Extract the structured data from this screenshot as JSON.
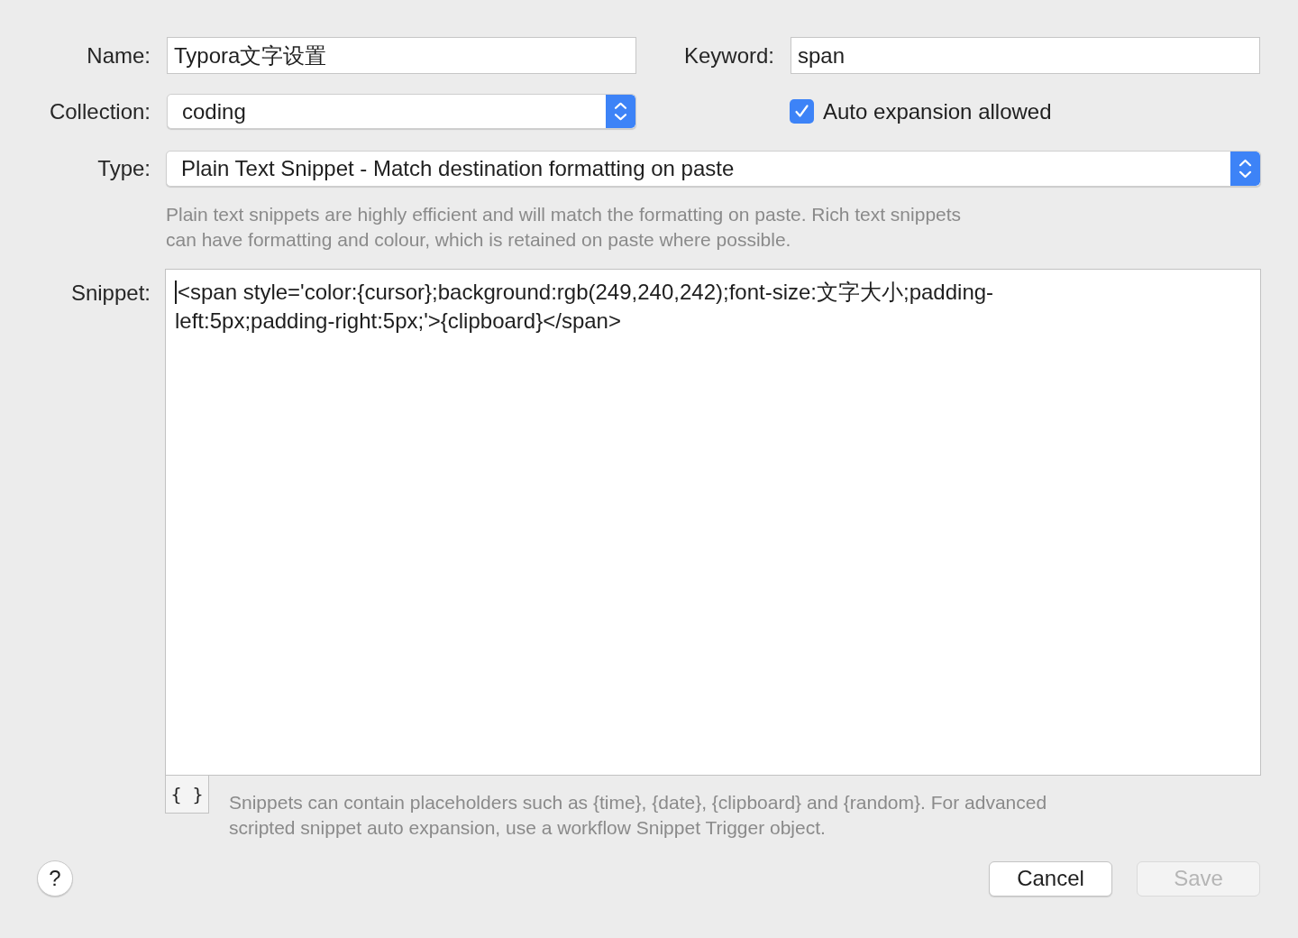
{
  "form": {
    "name": {
      "label": "Name:",
      "value": "Typora文字设置"
    },
    "keyword": {
      "label": "Keyword:",
      "value": "span"
    },
    "collection": {
      "label": "Collection:",
      "value": "coding"
    },
    "auto_expansion": {
      "label": "Auto expansion allowed",
      "checked": true
    },
    "type": {
      "label": "Type:",
      "value": "Plain Text Snippet - Match destination formatting on paste"
    },
    "type_description": "Plain text snippets are highly efficient and will match the formatting on paste. Rich text snippets can have formatting and colour, which is retained on paste where possible.",
    "snippet": {
      "label": "Snippet:",
      "value": "<span style='color:{cursor};background:rgb(249,240,242);font-size:文字大小;padding-left:5px;padding-right:5px;'>{clipboard}</span>"
    },
    "placeholder_button": {
      "label": "{ }"
    },
    "snippet_help": "Snippets can contain placeholders such as {time}, {date}, {clipboard} and {random}. For advanced scripted snippet auto expansion, use a workflow Snippet Trigger object."
  },
  "help_button": {
    "label": "?"
  },
  "buttons": [
    {
      "label": "Cancel",
      "disabled": false
    },
    {
      "label": "Save",
      "disabled": true
    }
  ]
}
